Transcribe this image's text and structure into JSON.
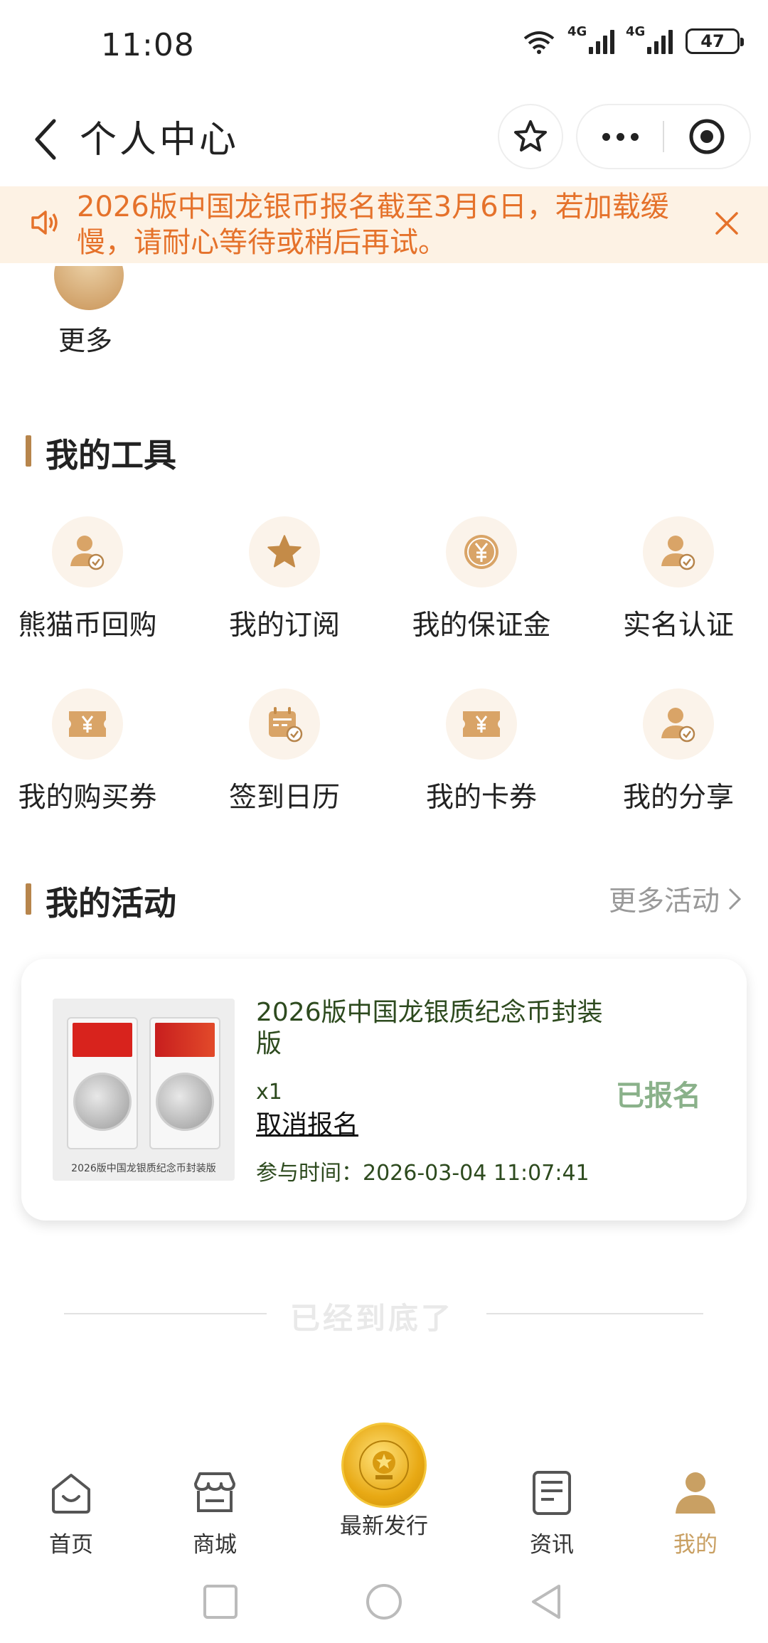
{
  "status_bar": {
    "time": "11:08",
    "battery": "47",
    "net1": "4G",
    "net2": "4G"
  },
  "header": {
    "title": "个人中心"
  },
  "notice": {
    "text": "2026版中国龙银币报名截至3月6日，若加载缓慢，请耐心等待或稍后再试。"
  },
  "more": {
    "label": "更多"
  },
  "tools": {
    "title": "我的工具",
    "items": [
      {
        "label": "熊猫币回购",
        "icon": "user-check-icon"
      },
      {
        "label": "我的订阅",
        "icon": "star-icon"
      },
      {
        "label": "我的保证金",
        "icon": "yen-coin-icon"
      },
      {
        "label": "实名认证",
        "icon": "user-check-icon"
      },
      {
        "label": "我的购买券",
        "icon": "yen-ticket-icon"
      },
      {
        "label": "签到日历",
        "icon": "calendar-check-icon"
      },
      {
        "label": "我的卡券",
        "icon": "yen-ticket-icon"
      },
      {
        "label": "我的分享",
        "icon": "user-check-icon"
      }
    ]
  },
  "activities": {
    "title": "我的活动",
    "more_label": "更多活动",
    "items": [
      {
        "name": "2026版中国龙银质纪念币封装版",
        "image_caption": "2026版中国龙银质纪念币封装版",
        "quantity": "x1",
        "cancel_label": "取消报名",
        "time_label": "参与时间：2026-03-04 11:07:41",
        "status": "已报名"
      }
    ]
  },
  "end_text": "已经到底了",
  "tabbar": {
    "items": [
      {
        "label": "首页",
        "icon": "home-icon"
      },
      {
        "label": "商城",
        "icon": "store-icon"
      },
      {
        "label": "最新发行",
        "icon": "national-emblem-icon"
      },
      {
        "label": "资讯",
        "icon": "news-icon"
      },
      {
        "label": "我的",
        "icon": "user-icon"
      }
    ],
    "active_color": "#c9a063"
  },
  "colors": {
    "accent": "#b7854c",
    "notice": "#e5722b",
    "notice_bg": "#fdf2e4",
    "status_green": "#8ab18a"
  }
}
